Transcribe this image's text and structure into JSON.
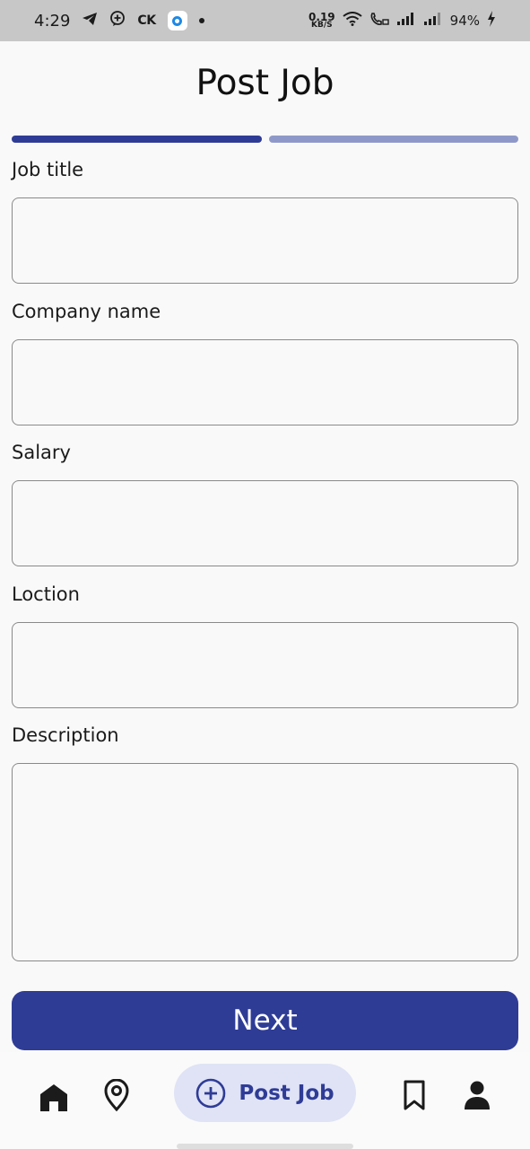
{
  "status_bar": {
    "time": "4:29",
    "carrier_label": "CK",
    "network_speed_value": "0.19",
    "network_speed_unit": "KB/S",
    "battery": "94%"
  },
  "page": {
    "title": "Post Job"
  },
  "progress": {
    "current_step": 1,
    "total_steps": 2,
    "active_color": "#2f3c96",
    "inactive_color": "#8f99c9"
  },
  "form": {
    "fields": [
      {
        "label": "Job title",
        "value": ""
      },
      {
        "label": "Company name",
        "value": ""
      },
      {
        "label": "Salary",
        "value": ""
      },
      {
        "label": "Loction",
        "value": ""
      },
      {
        "label": "Description",
        "value": ""
      }
    ],
    "next_label": "Next"
  },
  "nav": {
    "items": [
      {
        "icon": "home-icon"
      },
      {
        "icon": "location-icon"
      },
      {
        "icon": "add-circle-icon",
        "label": "Post Job",
        "selected": true
      },
      {
        "icon": "bookmark-icon"
      },
      {
        "icon": "person-icon"
      }
    ]
  },
  "colors": {
    "accent": "#2f3c96",
    "nav_selected_bg": "#dfe3f5"
  }
}
